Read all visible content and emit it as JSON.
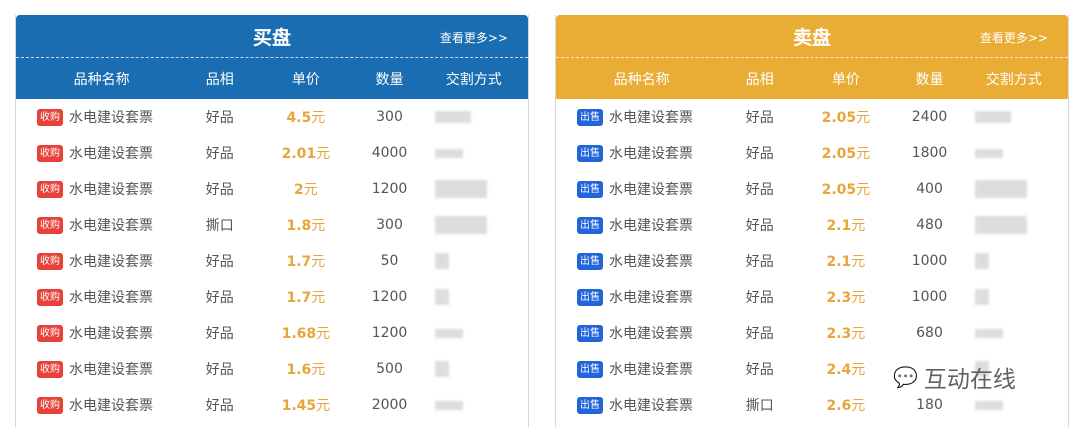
{
  "columns": [
    "品种名称",
    "品相",
    "单价",
    "数量",
    "交割方式"
  ],
  "buy": {
    "title": "买盘",
    "more": "查看更多>>",
    "badge": "收购",
    "rows": [
      {
        "name": "水电建设套票",
        "cond": "好品",
        "price": "4.5",
        "unit": "元",
        "qty": "300"
      },
      {
        "name": "水电建设套票",
        "cond": "好品",
        "price": "2.01",
        "unit": "元",
        "qty": "4000"
      },
      {
        "name": "水电建设套票",
        "cond": "好品",
        "price": "2",
        "unit": "元",
        "qty": "1200"
      },
      {
        "name": "水电建设套票",
        "cond": "撕口",
        "price": "1.8",
        "unit": "元",
        "qty": "300"
      },
      {
        "name": "水电建设套票",
        "cond": "好品",
        "price": "1.7",
        "unit": "元",
        "qty": "50"
      },
      {
        "name": "水电建设套票",
        "cond": "好品",
        "price": "1.7",
        "unit": "元",
        "qty": "1200"
      },
      {
        "name": "水电建设套票",
        "cond": "好品",
        "price": "1.68",
        "unit": "元",
        "qty": "1200"
      },
      {
        "name": "水电建设套票",
        "cond": "好品",
        "price": "1.6",
        "unit": "元",
        "qty": "500"
      },
      {
        "name": "水电建设套票",
        "cond": "好品",
        "price": "1.45",
        "unit": "元",
        "qty": "2000"
      }
    ]
  },
  "sell": {
    "title": "卖盘",
    "more": "查看更多>>",
    "badge": "出售",
    "rows": [
      {
        "name": "水电建设套票",
        "cond": "好品",
        "price": "2.05",
        "unit": "元",
        "qty": "2400"
      },
      {
        "name": "水电建设套票",
        "cond": "好品",
        "price": "2.05",
        "unit": "元",
        "qty": "1800"
      },
      {
        "name": "水电建设套票",
        "cond": "好品",
        "price": "2.05",
        "unit": "元",
        "qty": "400"
      },
      {
        "name": "水电建设套票",
        "cond": "好品",
        "price": "2.1",
        "unit": "元",
        "qty": "480"
      },
      {
        "name": "水电建设套票",
        "cond": "好品",
        "price": "2.1",
        "unit": "元",
        "qty": "1000"
      },
      {
        "name": "水电建设套票",
        "cond": "好品",
        "price": "2.3",
        "unit": "元",
        "qty": "1000"
      },
      {
        "name": "水电建设套票",
        "cond": "好品",
        "price": "2.3",
        "unit": "元",
        "qty": "680"
      },
      {
        "name": "水电建设套票",
        "cond": "好品",
        "price": "2.4",
        "unit": "元",
        "qty": ""
      },
      {
        "name": "水电建设套票",
        "cond": "撕口",
        "price": "2.6",
        "unit": "元",
        "qty": "180"
      }
    ]
  },
  "watermark": {
    "text": "互动在线",
    "icon": "wechat-icon"
  },
  "colors": {
    "buy_header": "#1a6db0",
    "sell_header": "#e9ad35",
    "price": "#e8a53a",
    "buy_badge": "#e8413a",
    "sell_badge": "#2264d9"
  }
}
